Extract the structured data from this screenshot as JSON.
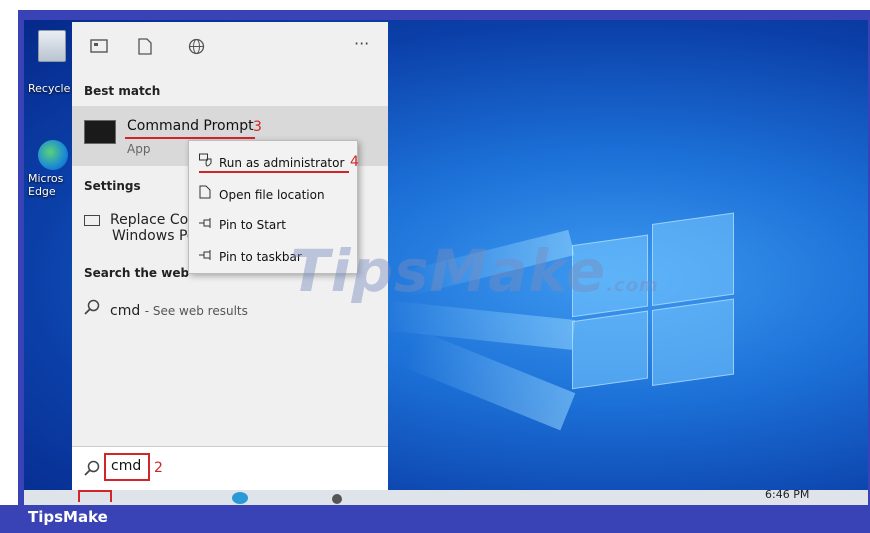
{
  "desktop": {
    "icons": [
      {
        "label": "Recycle",
        "icon": "recycle-bin-icon"
      },
      {
        "label": "Micros\nEdge",
        "icon": "edge-icon"
      }
    ],
    "clock": "6:46 PM"
  },
  "start_menu": {
    "top_icons": [
      "apps-icon",
      "document-icon",
      "web-icon",
      "more-icon"
    ],
    "more_label": "···",
    "best_match_header": "Best match",
    "best_match": {
      "title": "Command Prompt",
      "subtitle": "App",
      "step": "3"
    },
    "settings_header": "Settings",
    "settings_item_line1": "Replace Cor",
    "settings_item_line2": "Windows Po",
    "search_web_header": "Search the web",
    "web_result": {
      "query": "cmd",
      "suffix": "- See web results"
    },
    "search_box": {
      "value": "cmd",
      "step": "2"
    }
  },
  "context_menu": {
    "items": [
      {
        "label": "Run as administrator",
        "icon": "shield-run-icon"
      },
      {
        "label": "Open file location",
        "icon": "file-location-icon"
      },
      {
        "label": "Pin to Start",
        "icon": "pin-icon"
      },
      {
        "label": "Pin to taskbar",
        "icon": "pin-icon"
      }
    ],
    "step": "4"
  },
  "watermark": {
    "text": "TipsMake",
    "suffix": ".com"
  },
  "footer_brand": "TipsMake",
  "colors": {
    "annotation_red": "#d2252a",
    "frame_blue": "#3a43b5",
    "desktop_blue": "#1b6fd6"
  }
}
